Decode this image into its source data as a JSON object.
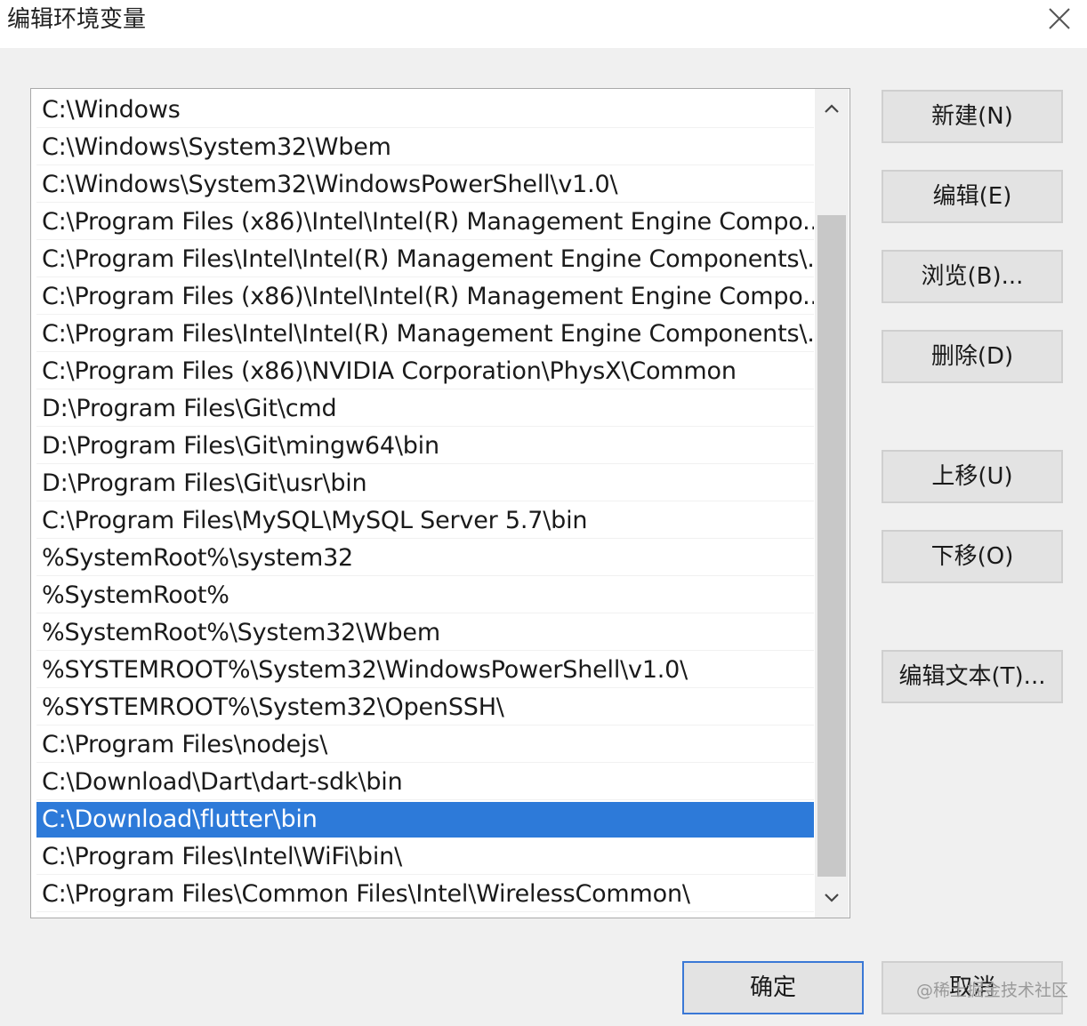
{
  "window": {
    "title": "编辑环境变量",
    "close_icon": "close-icon"
  },
  "path_list": {
    "items": [
      "C:\\Windows",
      "C:\\Windows\\System32\\Wbem",
      "C:\\Windows\\System32\\WindowsPowerShell\\v1.0\\",
      "C:\\Program Files (x86)\\Intel\\Intel(R) Management Engine Compo...",
      "C:\\Program Files\\Intel\\Intel(R) Management Engine Components\\...",
      "C:\\Program Files (x86)\\Intel\\Intel(R) Management Engine Compo...",
      "C:\\Program Files\\Intel\\Intel(R) Management Engine Components\\...",
      "C:\\Program Files (x86)\\NVIDIA Corporation\\PhysX\\Common",
      "D:\\Program Files\\Git\\cmd",
      "D:\\Program Files\\Git\\mingw64\\bin",
      "D:\\Program Files\\Git\\usr\\bin",
      "C:\\Program Files\\MySQL\\MySQL Server 5.7\\bin",
      "%SystemRoot%\\system32",
      "%SystemRoot%",
      "%SystemRoot%\\System32\\Wbem",
      "%SYSTEMROOT%\\System32\\WindowsPowerShell\\v1.0\\",
      "%SYSTEMROOT%\\System32\\OpenSSH\\",
      "C:\\Program Files\\nodejs\\",
      "C:\\Download\\Dart\\dart-sdk\\bin",
      "C:\\Download\\flutter\\bin",
      "C:\\Program Files\\Intel\\WiFi\\bin\\",
      "C:\\Program Files\\Common Files\\Intel\\WirelessCommon\\"
    ],
    "selected_value": "C:\\Download\\flutter\\bin"
  },
  "buttons": {
    "new": "新建(N)",
    "edit": "编辑(E)",
    "browse": "浏览(B)...",
    "delete": "删除(D)",
    "move_up": "上移(U)",
    "move_down": "下移(O)",
    "edit_text": "编辑文本(T)...",
    "ok": "确定",
    "cancel": "取消"
  },
  "watermark": "@稀土掘金技术社区",
  "colors": {
    "selection": "#2d7ad9",
    "default_button_border": "#3a78d6"
  }
}
